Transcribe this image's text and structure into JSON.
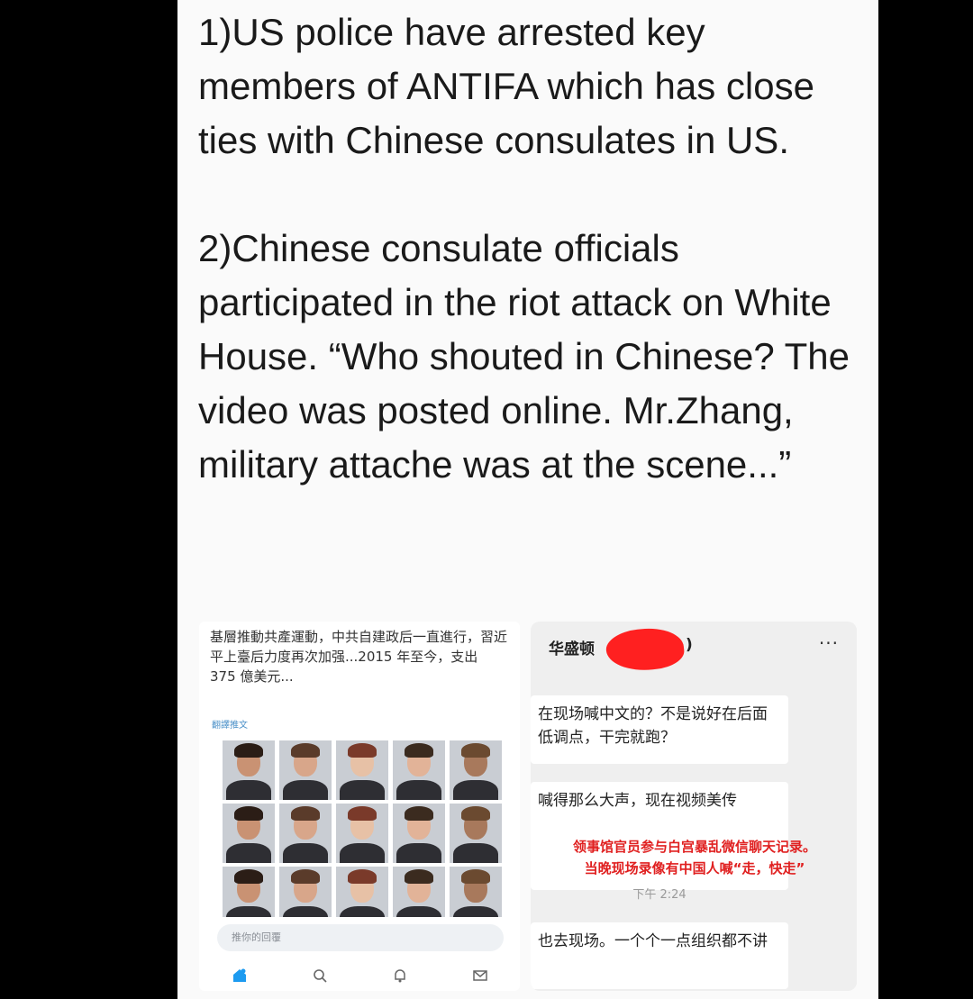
{
  "post": {
    "paragraphs": [
      "1)US police have arrested key members of ANTIFA which has close ties with Chinese consulates in US.",
      "2)Chinese consulate officials participated in the riot attack on White House. “Who shouted in Chinese? The video was posted online. Mr.Zhang, military attache was at the scene...”"
    ]
  },
  "tweet": {
    "text": "基層推動共產運動，中共自建政后一直進行，習近平上臺后力度再次加强...2015 年至今，支出 375 億美元...",
    "translate_label": "翻譯推文",
    "reply_placeholder": "推你的回覆",
    "tab_icons": [
      "home-icon",
      "search-icon",
      "notifications-icon",
      "messages-icon"
    ],
    "mugshot_count": 15
  },
  "chat": {
    "title_visible": "华盛顿",
    "title_tail": ")",
    "more_label": "···",
    "messages": [
      "在现场喊中文的？不是说好在后面低调点，干完就跑？",
      "喊得那么大声，现在视频美传",
      "也去现场。一个个一点组织都不讲"
    ],
    "caption": "领事馆官员参与白宫暴乱微信聊天记录。\n当晚现场录像有中国人喊“走，快走”",
    "time": "下午 2:24",
    "redaction_color": "#ff2020",
    "caption_color": "#e02020"
  }
}
